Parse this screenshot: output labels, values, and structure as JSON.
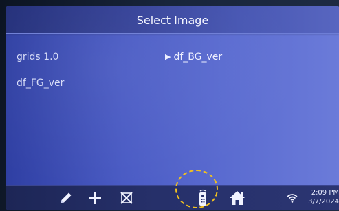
{
  "header": {
    "title": "Select Image"
  },
  "images": [
    {
      "label": "grids 1.0",
      "selected": false
    },
    {
      "label": "df_BG_ver",
      "selected": true
    },
    {
      "label": "df_FG_ver",
      "selected": false
    }
  ],
  "selection_marker": "▶",
  "taskbar": {
    "buttons": [
      {
        "icon": "pencil-icon",
        "label": "edit"
      },
      {
        "icon": "plus-icon",
        "label": "add"
      },
      {
        "icon": "delete-x-icon",
        "label": "delete"
      },
      {
        "icon": "remote-control-icon",
        "label": "remote"
      },
      {
        "icon": "home-icon",
        "label": "home"
      }
    ],
    "status_icon": "wifi-icon",
    "time": "2:09 PM",
    "date": "3/7/2024"
  },
  "colors": {
    "screen_blue": "#4a5bc4",
    "header_blue": "#36439a",
    "taskbar_navy": "#26306a",
    "highlight_ring": "#f0c020",
    "text": "#eef0ff"
  }
}
